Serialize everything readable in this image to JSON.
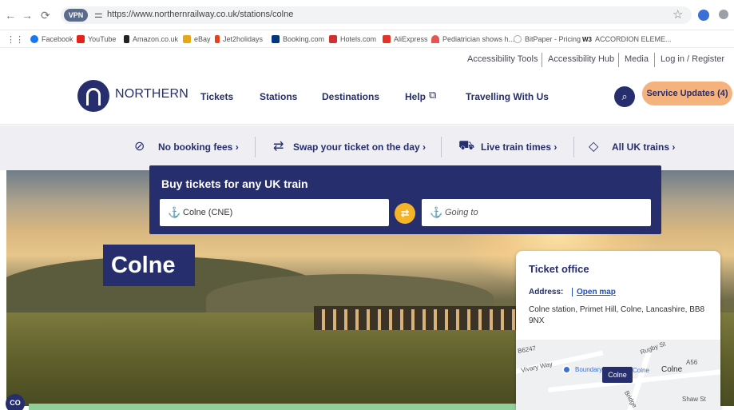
{
  "browser": {
    "vpn_label": "VPN",
    "url": "https://www.northernrailway.co.uk/stations/colne",
    "bookmarks": [
      "Facebook",
      "YouTube",
      "Amazon.co.uk",
      "eBay",
      "Jet2holidays",
      "Booking.com",
      "Hotels.com",
      "AliExpress",
      "Pediatrician shows h...",
      "BitPaper - Pricing",
      "ACCORDION ELEME..."
    ]
  },
  "utility": {
    "links": [
      "Accessibility Tools",
      "Accessibility Hub",
      "Media",
      "Log in / Register"
    ]
  },
  "header": {
    "brand": "NORTHERN",
    "nav": [
      "Tickets",
      "Stations",
      "Destinations",
      "Help",
      "Travelling With Us"
    ],
    "service_updates": "Service Updates (4)"
  },
  "features": [
    {
      "label": "No booking fees",
      "icon": "no-fee-icon"
    },
    {
      "label": "Swap your ticket on the day",
      "icon": "swap-ticket-icon"
    },
    {
      "label": "Live train times",
      "icon": "train-icon"
    },
    {
      "label": "All UK trains",
      "icon": "ticket-icon"
    }
  ],
  "booking": {
    "title": "Buy tickets for any UK train",
    "from_value": "Colne (CNE)",
    "to_placeholder": "Going to"
  },
  "station": {
    "name": "Colne"
  },
  "ticket_office": {
    "title": "Ticket office",
    "address_label": "Address:",
    "open_map": "Open map",
    "address": "Colne station, Primet Hill, Colne, Lancashire, BB8 9NX",
    "map": {
      "pin_label": "Colne",
      "labels": [
        "B6247",
        "Vivary Way",
        "Boundary",
        "Colne",
        "Colne",
        "A56",
        "Shaw St",
        "Rugby St",
        "Bridge"
      ]
    }
  },
  "badge": "CO"
}
